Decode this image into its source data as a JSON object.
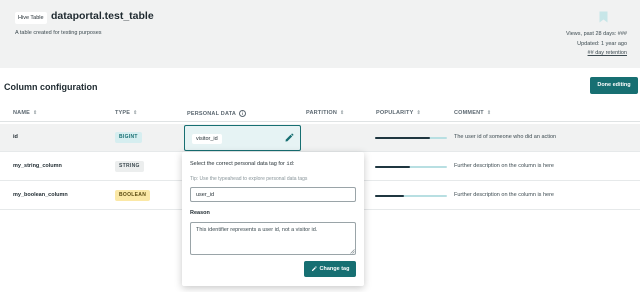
{
  "header": {
    "type_badge": "Hive Table",
    "table_name": "dataportal.test_table",
    "description": "A table created for testing purposes",
    "views": "Views, past 28 days: ###",
    "updated": "Updated: 1 year ago",
    "retention": "## day retention"
  },
  "section": {
    "title": "Column configuration",
    "done_button": "Done editing"
  },
  "columns": {
    "name": "NAME",
    "type": "TYPE",
    "personal_data": "PERSONAL DATA",
    "partition": "PARTITION",
    "popularity": "POPULARITY",
    "comment": "COMMENT",
    "sort_glyph": "⇕",
    "info_glyph": "i"
  },
  "rows": [
    {
      "name": "id",
      "type": "BIGINT",
      "type_bg": "#d6eef0",
      "type_fg": "#176f72",
      "personal_data": "visitor_id",
      "popularity": 0.76,
      "comment": "The user id of someone who did an action"
    },
    {
      "name": "my_string_column",
      "type": "STRING",
      "type_bg": "#eceeee",
      "type_fg": "#3c4a50",
      "popularity": 0.48,
      "comment": "Further description on the column is here"
    },
    {
      "name": "my_boolean_column",
      "type": "BOOLEAN",
      "type_bg": "#fbe8a6",
      "type_fg": "#5a4a10",
      "popularity": 0.4,
      "comment": "Further description on the column is here"
    }
  ],
  "popover": {
    "prompt_prefix": "Select the correct personal data tag for",
    "prompt_column": "id",
    "prompt_suffix": ":",
    "tip": "Tip: Use the typeahead to explore personal data tags",
    "input_value": "user_id",
    "reason_label": "Reason",
    "reason_value": "This identifier represents a user id, not a visitor id.",
    "change_button": "Change tag"
  },
  "colors": {
    "accent": "#176f72",
    "header_bg": "#f1f2f2",
    "popularity_track": "#b8dfe2",
    "popularity_fill": "#1f3640"
  }
}
